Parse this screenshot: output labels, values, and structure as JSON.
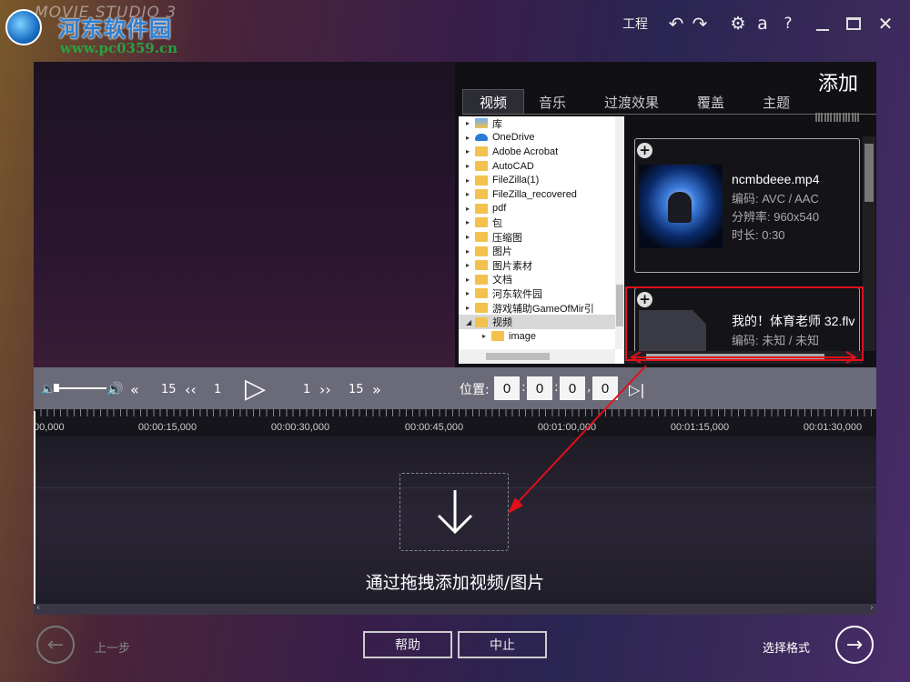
{
  "watermark": {
    "site_name": "河东软件园",
    "url": "www.pc0359.cn"
  },
  "titlebar": {
    "app_name": "MOVIE STUDIO 3",
    "project_label": "工程",
    "a_label": "a",
    "help_label": "?"
  },
  "add_panel": {
    "title": "添加",
    "tabs": [
      {
        "label": "视频"
      },
      {
        "label": "音乐"
      },
      {
        "label": "过渡效果"
      },
      {
        "label": "覆盖"
      },
      {
        "label": "主题"
      }
    ],
    "tree": [
      {
        "label": "库"
      },
      {
        "label": "OneDrive"
      },
      {
        "label": "Adobe Acrobat"
      },
      {
        "label": "AutoCAD"
      },
      {
        "label": "FileZilla(1)"
      },
      {
        "label": "FileZilla_recovered"
      },
      {
        "label": "pdf"
      },
      {
        "label": "包"
      },
      {
        "label": "压缩图"
      },
      {
        "label": "图片"
      },
      {
        "label": "图片素材"
      },
      {
        "label": "文档"
      },
      {
        "label": "河东软件园"
      },
      {
        "label": "游戏辅助GameOfMir引"
      },
      {
        "label": "视频"
      },
      {
        "label": "image"
      }
    ],
    "files": [
      {
        "name": "ncmbdeee.mp4",
        "codec": "编码: AVC / AAC",
        "resolution": "分辨率: 960x540",
        "duration": "时长: 0:30"
      },
      {
        "name": "我的！体育老师 32.flv",
        "codec": "编码: 未知 / 未知"
      }
    ]
  },
  "playback": {
    "skip_back_big": "15",
    "skip_back_small": "1",
    "skip_fwd_small": "1",
    "skip_fwd_big": "15",
    "position_label": "位置:",
    "position": [
      "0",
      "0",
      "0",
      "0"
    ]
  },
  "timeline": {
    "ruler_labels": [
      "00,000",
      "00:00:15,000",
      "00:00:30,000",
      "00:00:45,000",
      "00:01:00,000",
      "00:01:15,000",
      "00:01:30,000"
    ],
    "drop_hint": "通过拖拽添加视频/图片"
  },
  "footer": {
    "prev_label": "上一步",
    "help_button": "帮助",
    "stop_button": "中止",
    "next_label": "选择格式"
  },
  "colors": {
    "annotation_red": "#e0101a",
    "playbar_bg": "#6a6a78"
  }
}
